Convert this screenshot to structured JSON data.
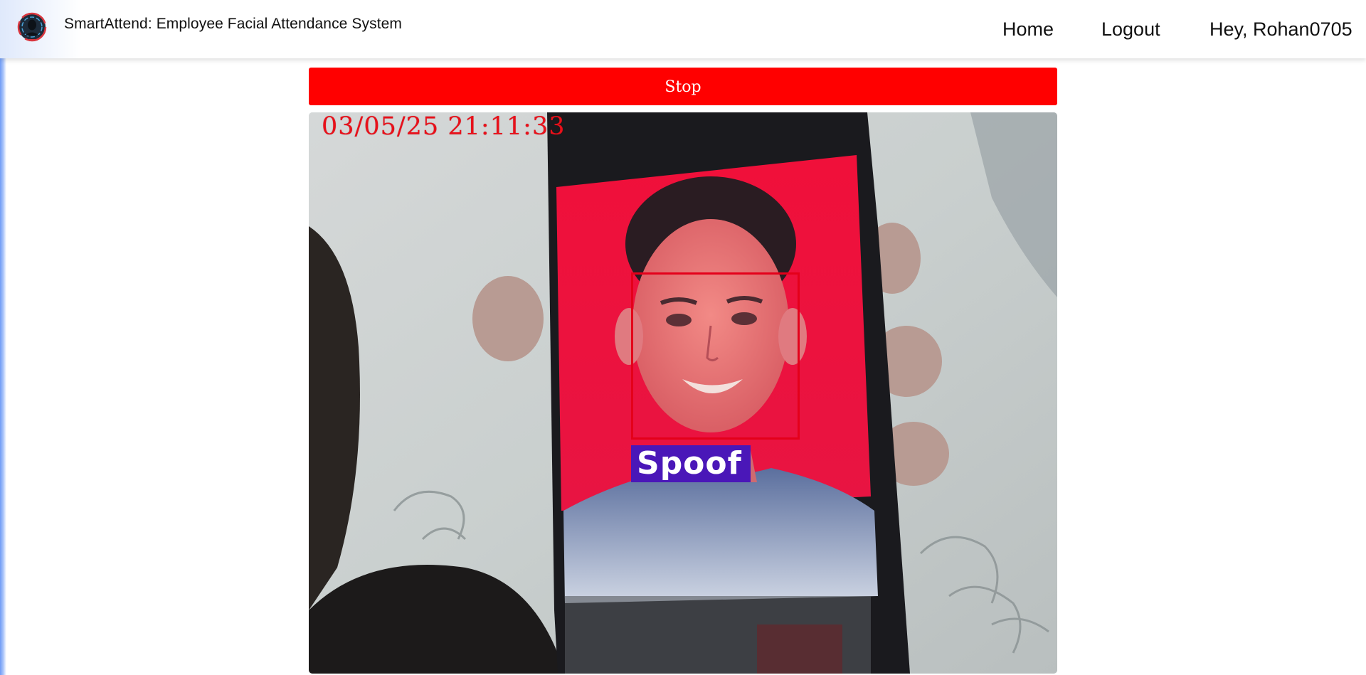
{
  "navbar": {
    "logo_icon": "face-scan-logo-icon",
    "brand_title": "SmartAttend: Employee Facial Attendance System",
    "links": {
      "home": "Home",
      "logout": "Logout",
      "user_greeting": "Hey, Rohan0705"
    }
  },
  "controls": {
    "stop_label": "Stop",
    "stop_color": "#ff0000"
  },
  "camera_feed": {
    "timestamp": "03/05/25 21:11:33",
    "detection_label": "Spoof",
    "detection_box_color": "#e4001a",
    "detection_label_color": "#4a17b8"
  }
}
